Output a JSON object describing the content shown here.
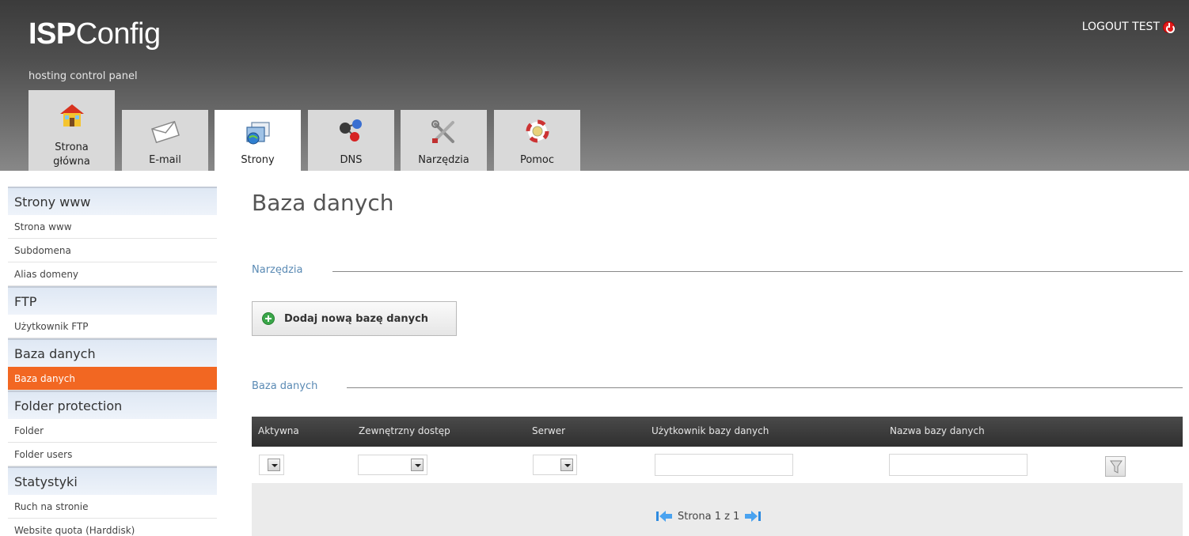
{
  "header": {
    "logo_bold": "ISP",
    "logo_light": "Config",
    "tagline": "hosting control panel",
    "logout_label": "LOGOUT TEST"
  },
  "tabs": [
    {
      "label_line1": "Strona",
      "label_line2": "główna",
      "icon": "home-icon"
    },
    {
      "label": "E-mail",
      "icon": "envelope-icon"
    },
    {
      "label": "Strony",
      "icon": "sites-icon",
      "active": true
    },
    {
      "label": "DNS",
      "icon": "dns-icon"
    },
    {
      "label": "Narzędzia",
      "icon": "tools-icon"
    },
    {
      "label": "Pomoc",
      "icon": "help-lifebuoy-icon"
    }
  ],
  "sidebar": {
    "groups": [
      {
        "heading": "Strony www",
        "items": [
          "Strona www",
          "Subdomena",
          "Alias domeny"
        ]
      },
      {
        "heading": "FTP",
        "items": [
          "Użytkownik FTP"
        ]
      },
      {
        "heading": "Baza danych",
        "items": [
          "Baza danych"
        ],
        "active_item": "Baza danych"
      },
      {
        "heading": "Folder protection",
        "items": [
          "Folder",
          "Folder users"
        ]
      },
      {
        "heading": "Statystyki",
        "items": [
          "Ruch na stronie",
          "Website quota (Harddisk)"
        ]
      }
    ]
  },
  "main": {
    "title": "Baza danych",
    "tools_section": "Narzędzia",
    "add_button": "Dodaj nową bazę danych",
    "list_section": "Baza danych",
    "columns": [
      "Aktywna",
      "Zewnętrzny dostęp",
      "Serwer",
      "Użytkownik bazy danych",
      "Nazwa bazy danych"
    ],
    "pager_text": "Strona 1 z 1"
  },
  "colors": {
    "accent_active": "#f26722",
    "section_blue": "#5a8ab4"
  }
}
